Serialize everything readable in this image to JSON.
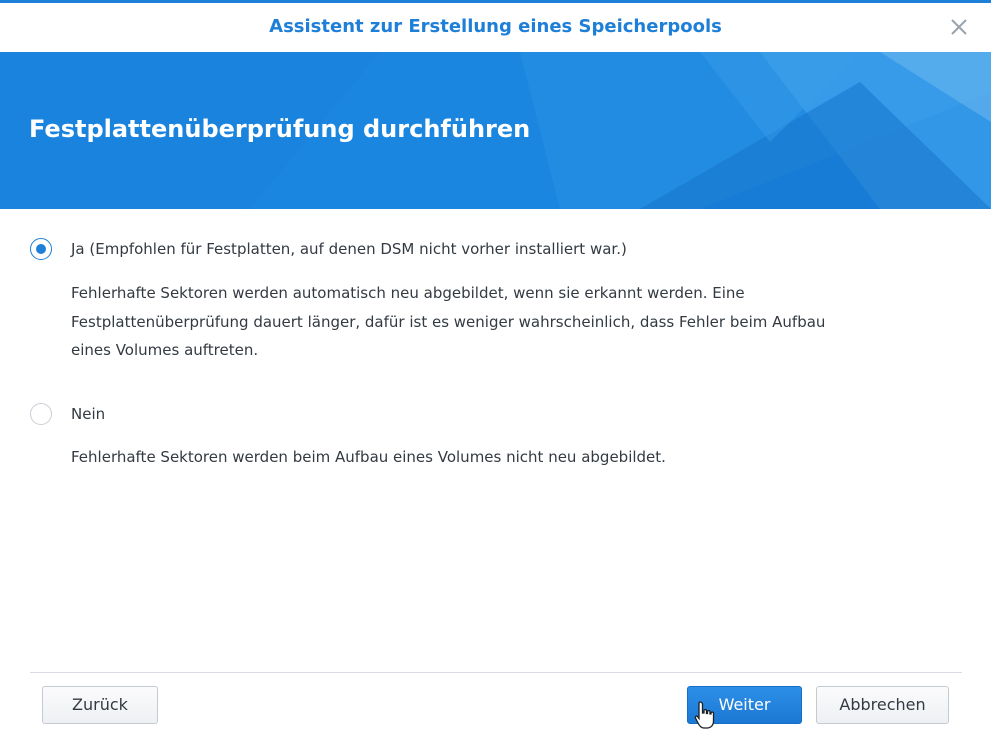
{
  "window": {
    "title": "Assistent zur Erstellung eines Speicherpools",
    "close_icon": "close-icon"
  },
  "banner": {
    "title": "Festplattenüberprüfung durchführen",
    "color": "#1a86e0"
  },
  "options": [
    {
      "label": "Ja (Empfohlen für Festplatten, auf denen DSM nicht vorher installiert war.)",
      "selected": true,
      "description_lines": [
        "Fehlerhafte Sektoren werden automatisch neu abgebildet, wenn sie erkannt werden. Eine",
        "Festplattenüberprüfung dauert länger, dafür ist es weniger wahrscheinlich, dass Fehler beim Aufbau",
        "eines Volumes auftreten."
      ]
    },
    {
      "label": "Nein",
      "selected": false,
      "description_lines": [
        "Fehlerhafte Sektoren werden beim Aufbau eines Volumes nicht neu abgebildet."
      ]
    }
  ],
  "footer": {
    "back_label": "Zurück",
    "next_label": "Weiter",
    "cancel_label": "Abbrechen"
  },
  "colors": {
    "accent": "#1e7fd8",
    "text": "#333a42"
  }
}
